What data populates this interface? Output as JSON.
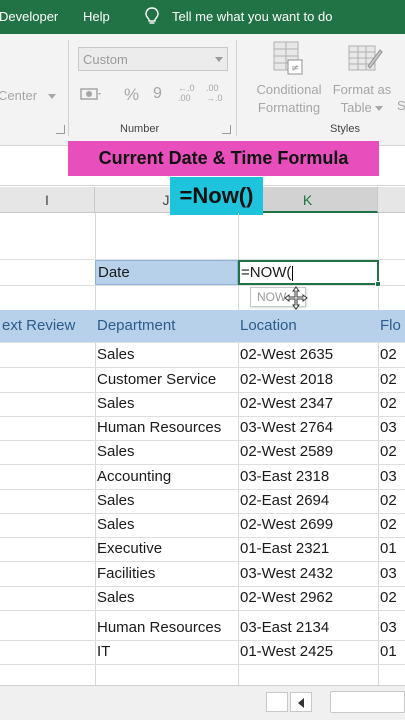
{
  "menu": {
    "developer": "Developer",
    "help": "Help",
    "tell_me": "Tell me what you want to do"
  },
  "ribbon": {
    "alignment_center": "Center",
    "number_format": "Custom",
    "percent_symbol": "%",
    "comma_symbol": "9",
    "increase_decimal": "←.0 .00",
    "decrease_decimal": ".00 →.0",
    "number_group": "Number",
    "conditional_formatting": [
      "Conditional",
      "Formatting"
    ],
    "format_as_table": [
      "Format as",
      "Table"
    ],
    "styles_group": "Styles",
    "extra_s": "S"
  },
  "banner": {
    "title": "Current Date & Time  Formula",
    "formula": "=Now()"
  },
  "columns": {
    "i": "I",
    "j": "J",
    "k": "K"
  },
  "date_row": {
    "label": "Date",
    "formula": "=NOW("
  },
  "autocomplete": "NOW",
  "headers": {
    "col_i": "ext Review",
    "col_j": "Department",
    "col_k": "Location",
    "col_l": "Flo"
  },
  "rows": [
    {
      "dept": "Sales",
      "loc": "02-West 2635",
      "floor": "02"
    },
    {
      "dept": "Customer Service",
      "loc": "02-West 2018",
      "floor": "02"
    },
    {
      "dept": "Sales",
      "loc": "02-West 2347",
      "floor": "02"
    },
    {
      "dept": "Human Resources",
      "loc": "03-West 2764",
      "floor": "03"
    },
    {
      "dept": "Sales",
      "loc": "02-West 2589",
      "floor": "02"
    },
    {
      "dept": "Accounting",
      "loc": "03-East 2318",
      "floor": "03"
    },
    {
      "dept": "Sales",
      "loc": "02-East 2694",
      "floor": "02"
    },
    {
      "dept": "Sales",
      "loc": "02-West 2699",
      "floor": "02"
    },
    {
      "dept": "Executive",
      "loc": "01-East 2321",
      "floor": "01"
    },
    {
      "dept": "Facilities",
      "loc": "03-West 2432",
      "floor": "03"
    },
    {
      "dept": "Sales",
      "loc": "02-West 2962",
      "floor": "02"
    },
    {
      "dept": "Human Resources",
      "loc": "03-East 2134",
      "floor": "03"
    },
    {
      "dept": "IT",
      "loc": "01-West 2425",
      "floor": "01"
    }
  ],
  "colors": {
    "excel_green": "#217346",
    "header_blue": "#b7d1ea",
    "banner_pink": "#e94fbc",
    "banner_cyan": "#1ec4dc"
  },
  "icons": [
    "lightbulb-icon",
    "currency-icon",
    "conditional-formatting-icon",
    "format-as-table-icon",
    "move-cursor-icon",
    "scroll-left-icon"
  ]
}
